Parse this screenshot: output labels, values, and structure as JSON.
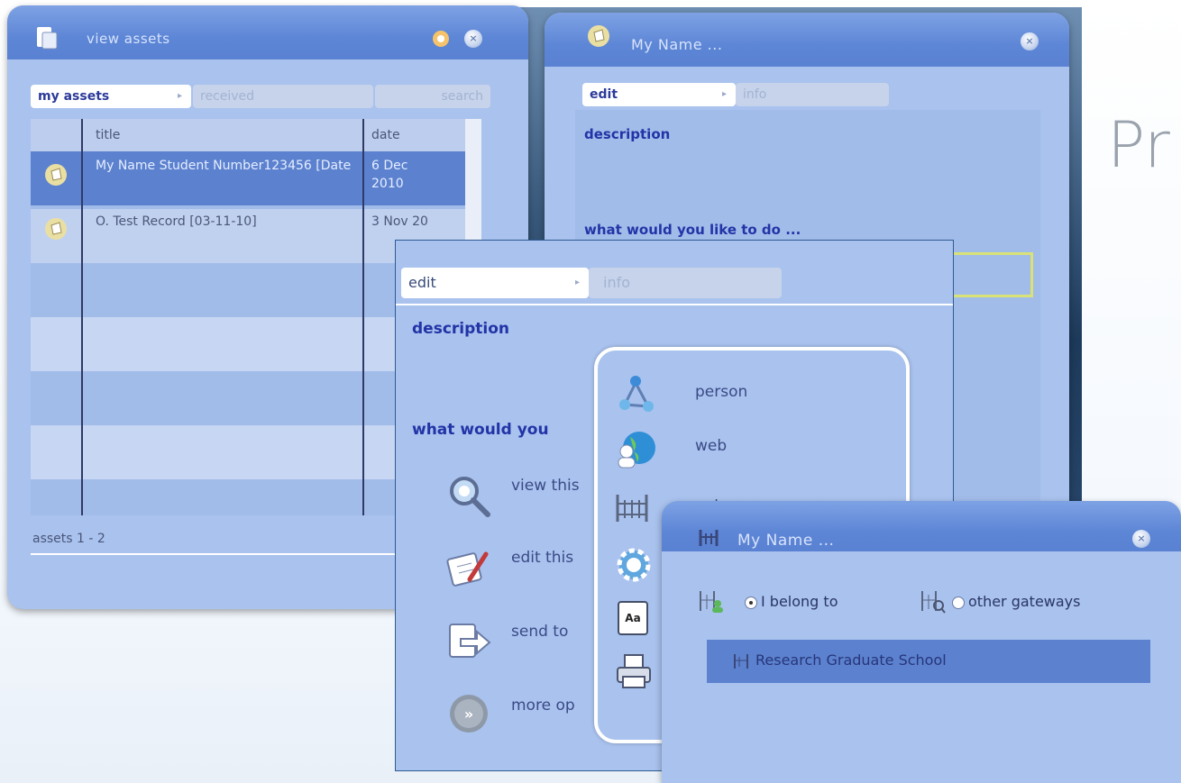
{
  "side_text": "Pr",
  "assets_window": {
    "title": "view assets",
    "tabs": [
      "my assets",
      "received",
      "search"
    ],
    "columns": [
      "title",
      "date"
    ],
    "rows": [
      {
        "title": "My Name Student Number123456 [Date",
        "date": "6 Dec 2010",
        "selected": true
      },
      {
        "title": "O. Test Record [03-11-10]",
        "date": "3 Nov 20",
        "selected": false
      }
    ],
    "footer": "assets 1 - 2"
  },
  "detail_window": {
    "title": "My Name ...",
    "tabs": [
      "edit",
      "info"
    ],
    "description_heading": "description",
    "question": "what would you like to do ..."
  },
  "edit_panel": {
    "tabs": [
      "edit",
      "info"
    ],
    "description_heading": "description",
    "question": "what would you",
    "actions": [
      {
        "icon": "magnifier-icon",
        "label": "view this"
      },
      {
        "icon": "edit-document-icon",
        "label": "edit this"
      },
      {
        "icon": "send-document-icon",
        "label": "send to"
      },
      {
        "icon": "more-options-icon",
        "label": "more op"
      }
    ],
    "popup_items": [
      {
        "icon": "person-network-icon",
        "label": "person"
      },
      {
        "icon": "web-globe-icon",
        "label": "web"
      },
      {
        "icon": "gateway-icon",
        "label": "gateway"
      },
      {
        "icon": "settings-gear-icon",
        "label": ""
      },
      {
        "icon": "font-icon",
        "label": ""
      },
      {
        "icon": "printer-icon",
        "label": ""
      }
    ]
  },
  "gateway_window": {
    "title": "My Name ...",
    "options": [
      {
        "label": "I belong to",
        "selected": true
      },
      {
        "label": "other gateways",
        "selected": false
      }
    ],
    "items": [
      "Research Graduate School"
    ]
  },
  "colors": {
    "window_bg": "#a9c2ee",
    "titlebar": "#5d86d6",
    "heading": "#2234a6",
    "selection": "#5c82cf"
  }
}
